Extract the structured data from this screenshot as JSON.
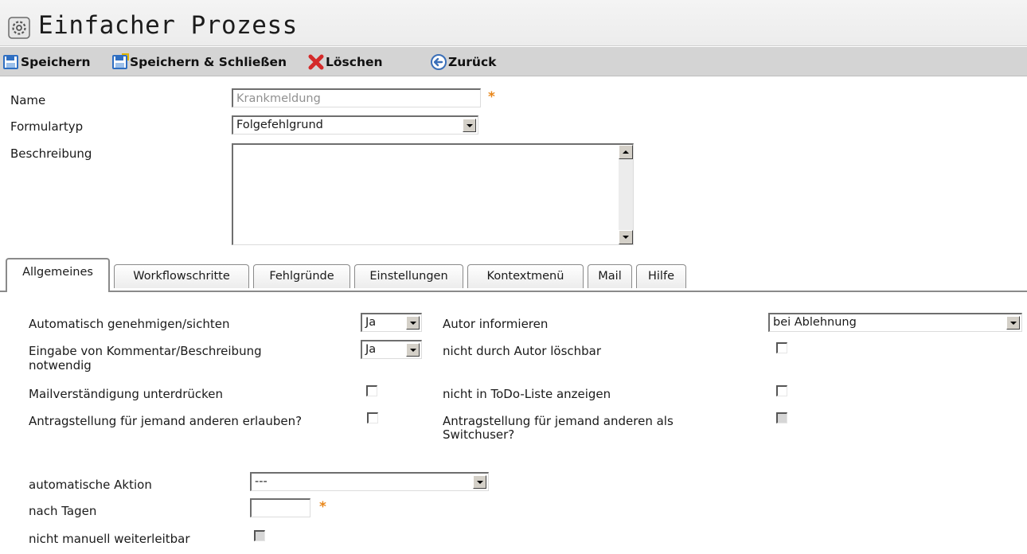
{
  "window": {
    "title": "Einfacher Prozess",
    "title_icon": "gear-icon"
  },
  "toolbar": {
    "save_label": "Speichern",
    "save_close_label": "Speichern & Schließen",
    "delete_label": "Löschen",
    "back_label": "Zurück"
  },
  "form": {
    "name_label": "Name",
    "name_value": "Krankmeldung",
    "required_mark": "*",
    "form_type_label": "Formulartyp",
    "form_type_value": "Folgefehlgrund",
    "description_label": "Beschreibung",
    "description_value": ""
  },
  "tabs": [
    {
      "label": "Allgemeines",
      "active": true
    },
    {
      "label": "Workflowschritte",
      "active": false
    },
    {
      "label": "Fehlgründe",
      "active": false
    },
    {
      "label": "Einstellungen",
      "active": false
    },
    {
      "label": "Kontextmenü",
      "active": false
    },
    {
      "label": "Mail",
      "active": false
    },
    {
      "label": "Hilfe",
      "active": false
    }
  ],
  "general": {
    "auto_approve_label": "Automatisch genehmigen/sichten",
    "auto_approve_value": "Ja",
    "comment_required_label_line1": "Eingabe von Kommentar/Beschreibung",
    "comment_required_label_line2": "notwendig",
    "comment_required_value": "Ja",
    "suppress_mail_label": "Mailverständigung unterdrücken",
    "suppress_mail_checked": false,
    "request_for_other_label": "Antragstellung für jemand anderen erlauben?",
    "request_for_other_checked": false,
    "inform_author_label": "Autor informieren",
    "inform_author_value": "bei Ablehnung",
    "not_deletable_label": "nicht durch Autor löschbar",
    "not_deletable_checked": false,
    "not_in_todo_label": "nicht in ToDo-Liste anzeigen",
    "not_in_todo_checked": false,
    "switchuser_label_line1": "Antragstellung für jemand anderen als",
    "switchuser_label_line2": "Switchuser?",
    "switchuser_checked": false,
    "auto_action_label": "automatische Aktion",
    "auto_action_value": "---",
    "after_days_label": "nach Tagen",
    "after_days_value": "",
    "not_forwardable_label": "nicht manuell weiterleitbar",
    "not_forwardable_checked": false
  },
  "colors": {
    "toolbar_bg": "#d4d4d4",
    "required_star": "#e8861a",
    "delete_icon": "#d42a2a",
    "save_icon": "#2f6fc2",
    "back_icon": "#3a6fb8"
  }
}
